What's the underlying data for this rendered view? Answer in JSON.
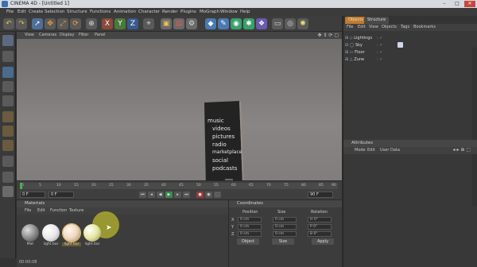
{
  "window": {
    "title": "CINEMA 4D - [Untitled 1]",
    "controls": [
      "–",
      "□",
      "✕"
    ]
  },
  "menubar": [
    "File",
    "Edit",
    "Create",
    "Selection",
    "Structure",
    "Functions",
    "Animation",
    "Character",
    "Render",
    "Plugins",
    "MoGraph",
    "Window",
    "Help"
  ],
  "toolbar": {
    "icons": [
      "undo-icon",
      "redo-icon",
      "live-select-icon",
      "move-icon",
      "scale-icon",
      "rotate-icon",
      "object-axis-icon",
      "x-axis-icon",
      "y-axis-icon",
      "z-axis-icon",
      "coordinate-system-icon",
      "render-view-icon",
      "render-picture-viewer-icon",
      "render-settings-icon",
      "cube-icon",
      "spline-pen-icon",
      "subdivision-surface-icon",
      "array-icon",
      "deformer-icon",
      "floor-icon",
      "camera-icon",
      "light-icon"
    ]
  },
  "viewport": {
    "menu": [
      "View",
      "Cameras",
      "Display",
      "Filter",
      "Panel"
    ],
    "screen_items": [
      "music",
      "videos",
      "pictures",
      "radio",
      "marketplace",
      "social",
      "podcasts"
    ],
    "colors": {
      "phone_body": "#2b2b2b",
      "phone_base": "#d9b8a8"
    }
  },
  "timeline": {
    "ticks": [
      "0",
      "5",
      "10",
      "15",
      "20",
      "25",
      "30",
      "35",
      "40",
      "45",
      "50",
      "55",
      "60",
      "65",
      "70",
      "75",
      "80",
      "85",
      "90"
    ],
    "start_frame": "0 F",
    "end_frame": "90 F",
    "current_frame": "0 F"
  },
  "materials": {
    "panel_title": "Materials",
    "menu": [
      "File",
      "Edit",
      "Function",
      "Texture"
    ],
    "items": [
      {
        "name": "Mat",
        "color": "#9a9a9a"
      },
      {
        "name": "light bar",
        "color": "#e8e8e8"
      },
      {
        "name": "light bar",
        "color": "#f0d8c0"
      },
      {
        "name": "light bar",
        "color": "#e6e6a0"
      }
    ]
  },
  "coordinates": {
    "panel_title": "Coordinates",
    "col_headers": [
      "Position",
      "Size",
      "Rotation"
    ],
    "rows": [
      {
        "axis": "X",
        "pos": "0 cm",
        "size": "0 cm",
        "rot": "H 0°"
      },
      {
        "axis": "Y",
        "pos": "0 cm",
        "size": "0 cm",
        "rot": "P 0°"
      },
      {
        "axis": "Z",
        "pos": "0 cm",
        "size": "0 cm",
        "rot": "B 0°"
      }
    ],
    "mode_object": "Object",
    "mode_size": "Size",
    "apply_label": "Apply"
  },
  "object_manager": {
    "tabs": [
      "Objects",
      "Structure"
    ],
    "menu": [
      "File",
      "Edit",
      "View",
      "Objects",
      "Tags",
      "Bookmarks"
    ],
    "items": [
      "Lightings",
      "Sky",
      "Floor",
      "Zune"
    ]
  },
  "attribute_manager": {
    "panel_title": "Attributes",
    "menu": [
      "Mode",
      "Edit",
      "User Data"
    ]
  },
  "status": {
    "text": "00:00:08"
  }
}
